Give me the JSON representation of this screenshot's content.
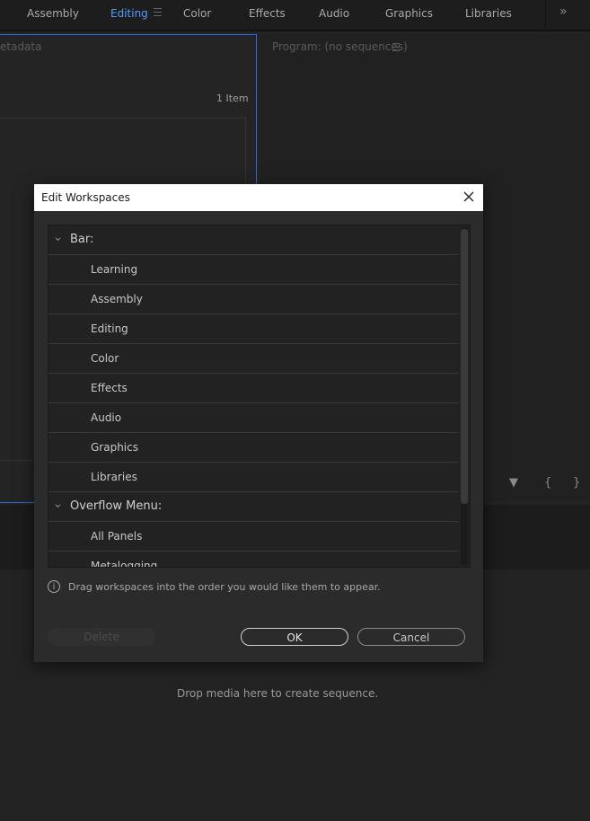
{
  "workspace_bar": {
    "tabs": [
      {
        "label": "Assembly"
      },
      {
        "label": "Editing",
        "active": true
      },
      {
        "label": "Color"
      },
      {
        "label": "Effects"
      },
      {
        "label": "Audio"
      },
      {
        "label": "Graphics"
      },
      {
        "label": "Libraries"
      }
    ],
    "overflow_glyph": "»"
  },
  "project_panel": {
    "tab_label": "etadata",
    "item_count": "1 Item"
  },
  "program_panel": {
    "tab_label": "Program: (no sequences)",
    "controls": [
      "▼",
      "{",
      "}"
    ]
  },
  "timeline": {
    "drop_hint": "Drop media here to create sequence."
  },
  "dialog": {
    "title": "Edit Workspaces",
    "groups": [
      {
        "label": "Bar:",
        "items": [
          "Learning",
          "Assembly",
          "Editing",
          "Color",
          "Effects",
          "Audio",
          "Graphics",
          "Libraries"
        ]
      },
      {
        "label": "Overflow Menu:",
        "items": [
          "All Panels",
          "Metalogging"
        ]
      }
    ],
    "info_text": "Drag workspaces into the order you would like them to appear.",
    "buttons": {
      "delete": "Delete",
      "ok": "OK",
      "cancel": "Cancel"
    }
  },
  "colors": {
    "accent": "#4e9fff",
    "panel_focus_border": "#2d6bd6",
    "dialog_bg": "#2b2b2b",
    "title_bar_bg": "#ffffff"
  }
}
